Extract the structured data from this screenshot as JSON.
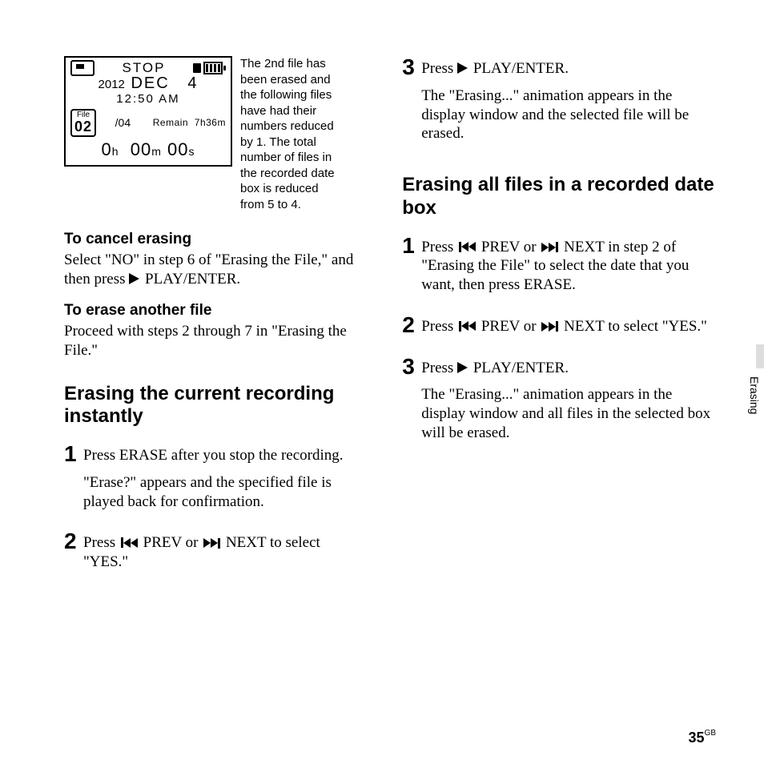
{
  "lcd": {
    "status": "STOP",
    "year": "2012",
    "month": "DEC",
    "day": "4",
    "time": "12:50 AM",
    "file_label": "File",
    "file_current": "02",
    "file_total": "/04",
    "remain_label": "Remain",
    "remain_value": "7h36m",
    "elapsed_h": "0",
    "elapsed_m": "00",
    "elapsed_s": "00",
    "unit_h": "h",
    "unit_m": "m",
    "unit_s": "s"
  },
  "annotation": "The 2nd file has been erased and the following files have had their numbers reduced by 1. The total number of files in the recorded date box is reduced from 5 to 4.",
  "left": {
    "cancel_head": "To cancel erasing",
    "cancel_body_a": "Select \"NO\" in step 6 of \"Erasing the File,\" and then press ",
    "cancel_body_b": " PLAY/ENTER.",
    "another_head": "To erase another file",
    "another_body": "Proceed with steps 2 through 7 in \"Erasing the File.\"",
    "section": "Erasing the current recording instantly",
    "step1a": "Press ERASE after you stop the recording.",
    "step1b": "\"Erase?\" appears and the specified file is played back for confirmation.",
    "step2a": "Press ",
    "step2b": " PREV or ",
    "step2c": " NEXT to select \"YES.\""
  },
  "right": {
    "step3a": "Press ",
    "step3b": " PLAY/ENTER.",
    "step3c": "The \"Erasing...\" animation appears in the display window and the selected file will be erased.",
    "section": "Erasing all files in a recorded date box",
    "r1a": "Press ",
    "r1b": " PREV or ",
    "r1c": " NEXT in step 2 of \"Erasing the File\" to select the date that you want, then press ERASE.",
    "r2a": "Press ",
    "r2b": " PREV or ",
    "r2c": " NEXT to select \"YES.\"",
    "r3a": "Press ",
    "r3b": " PLAY/ENTER.",
    "r3c": "The \"Erasing...\" animation appears in the display window and all files in the selected box will be erased."
  },
  "nums": {
    "n1": "1",
    "n2": "2",
    "n3": "3"
  },
  "side_tab": "Erasing",
  "page_number": "35",
  "page_suffix": "GB"
}
